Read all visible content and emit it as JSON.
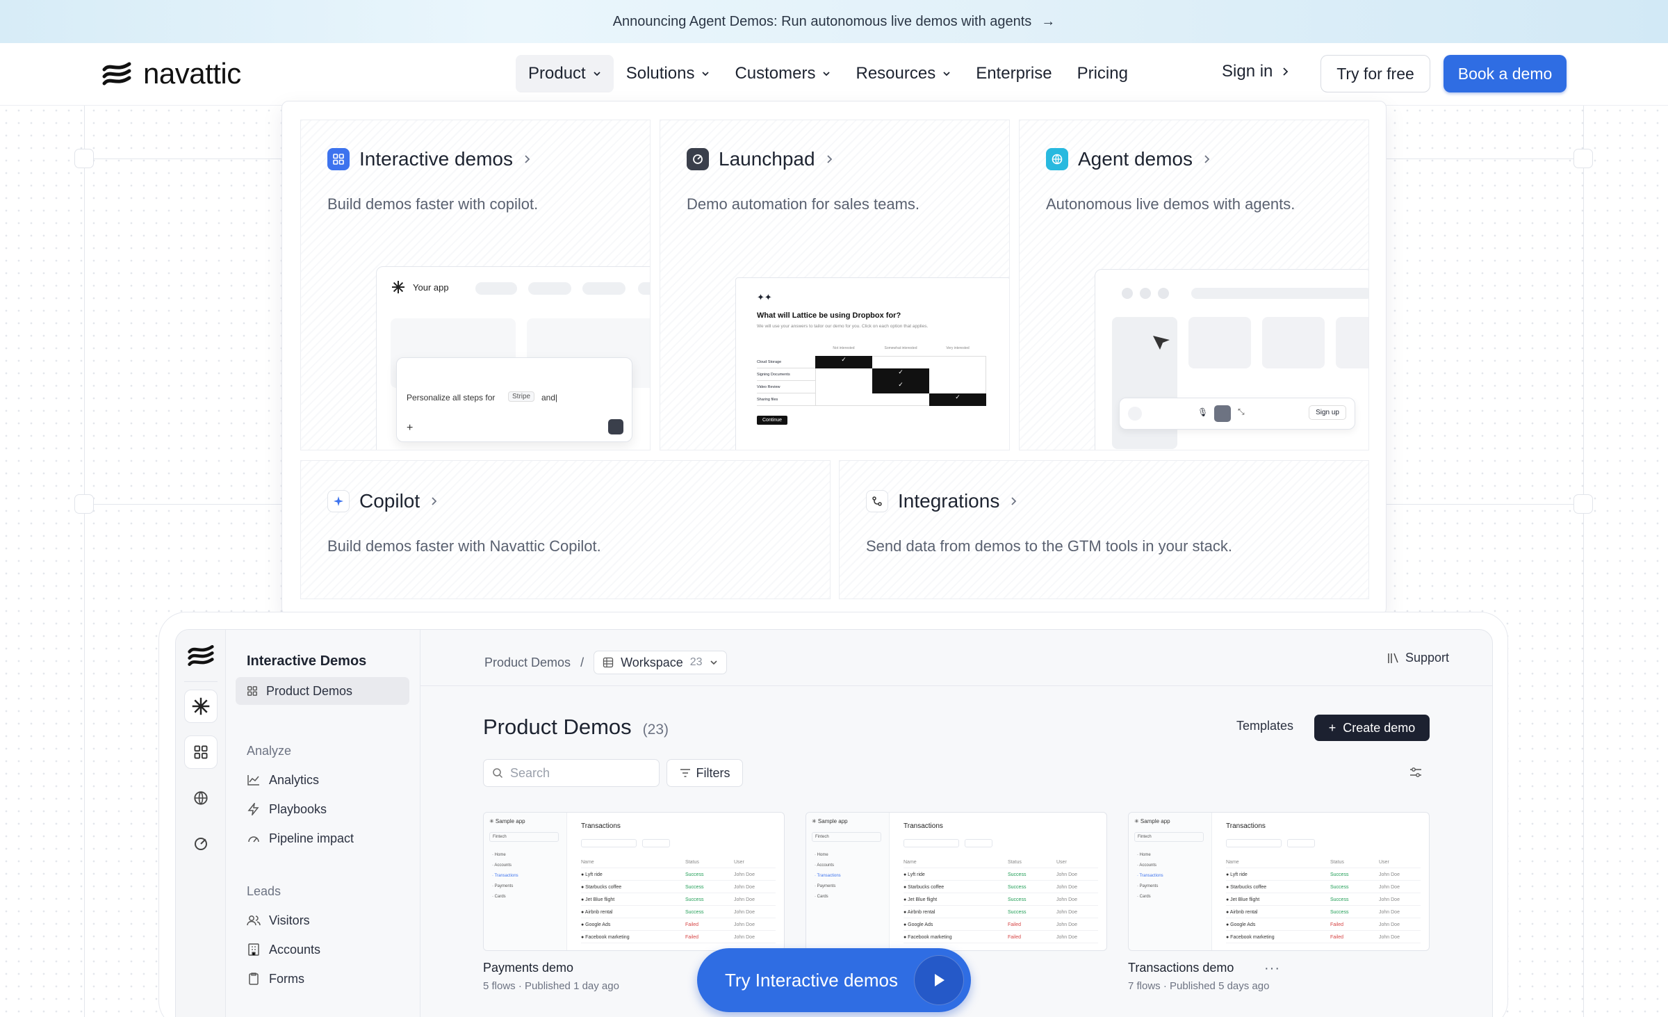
{
  "banner": {
    "text": "Announcing Agent Demos: Run autonomous live demos with agents",
    "arrow": "→"
  },
  "nav": {
    "brand": "navattic",
    "menu": [
      {
        "label": "Product",
        "has_chevron": true,
        "active": true
      },
      {
        "label": "Solutions",
        "has_chevron": true
      },
      {
        "label": "Customers",
        "has_chevron": true
      },
      {
        "label": "Resources",
        "has_chevron": true
      },
      {
        "label": "Enterprise",
        "has_chevron": false
      },
      {
        "label": "Pricing",
        "has_chevron": false
      }
    ],
    "sign_in": "Sign in",
    "try_free": "Try for free",
    "book_demo": "Book a demo"
  },
  "dropdown": {
    "cards": [
      {
        "title": "Interactive demos",
        "desc": "Build demos faster with copilot.",
        "icon": "grid-icon"
      },
      {
        "title": "Launchpad",
        "desc": "Demo automation for sales teams.",
        "icon": "launchpad-icon"
      },
      {
        "title": "Agent demos",
        "desc": "Autonomous live demos with agents.",
        "icon": "globe-icon"
      },
      {
        "title": "Copilot",
        "desc": "Build demos faster with Navattic Copilot.",
        "icon": "sparkle-icon"
      },
      {
        "title": "Integrations",
        "desc": "Send data from demos to the GTM tools in your stack.",
        "icon": "integrations-icon"
      }
    ],
    "preview_interactive": {
      "app_label": "Your app",
      "prompt_prefix": "Personalize all steps for",
      "prompt_chip": "Stripe",
      "prompt_suffix": "and|"
    },
    "preview_launchpad": {
      "question": "What will Lattice be using Dropbox for?",
      "sub": "We will use your answers to tailor our demo for you. Click on each option that applies.",
      "columns": [
        "Not interested",
        "Somewhat interested",
        "Very interested"
      ],
      "rows": [
        "Cloud Storage",
        "Signing Documents",
        "Video Review",
        "Sharing files"
      ],
      "continue": "Continue"
    },
    "preview_agent": {
      "sign_up": "Sign up"
    }
  },
  "app": {
    "sidebar_title": "Interactive Demos",
    "selected_item": "Product Demos",
    "analyze_label": "Analyze",
    "analyze_items": [
      "Analytics",
      "Playbooks",
      "Pipeline impact"
    ],
    "leads_label": "Leads",
    "leads_items": [
      "Visitors",
      "Accounts",
      "Forms"
    ],
    "breadcrumb_root": "Product Demos",
    "breadcrumb_sep": "/",
    "workspace": "Workspace",
    "workspace_count": "23",
    "support": "Support",
    "page_title": "Product Demos",
    "page_count": "(23)",
    "templates": "Templates",
    "create_demo": "Create demo",
    "search_placeholder": "Search",
    "filters": "Filters",
    "thumb": {
      "app": "Sample app",
      "org": "Fintech",
      "heading": "Transactions",
      "nav": [
        "Home",
        "Accounts",
        "Transactions",
        "Payments",
        "Cards"
      ],
      "cols": [
        "Name",
        "Status",
        "User"
      ],
      "rows": [
        [
          "Lyft ride",
          "Success",
          "John Doe"
        ],
        [
          "Starbucks coffee",
          "Success",
          "John Doe"
        ],
        [
          "Jet Blue flight",
          "Success",
          "John Doe"
        ],
        [
          "Airbnb rental",
          "Success",
          "John Doe"
        ],
        [
          "Google Ads",
          "Failed",
          "John Doe"
        ],
        [
          "Facebook marketing",
          "Failed",
          "John Doe"
        ]
      ]
    },
    "demos": [
      {
        "name": "Payments demo",
        "meta": "5 flows · Published 1 day ago"
      },
      {
        "name": "",
        "meta": ""
      },
      {
        "name": "Transactions demo",
        "meta": "7 flows · Published 5 days ago"
      }
    ],
    "more": "···"
  },
  "cta": {
    "label": "Try Interactive demos"
  },
  "colors": {
    "accent": "#2f6de3",
    "dark": "#1c2130"
  }
}
